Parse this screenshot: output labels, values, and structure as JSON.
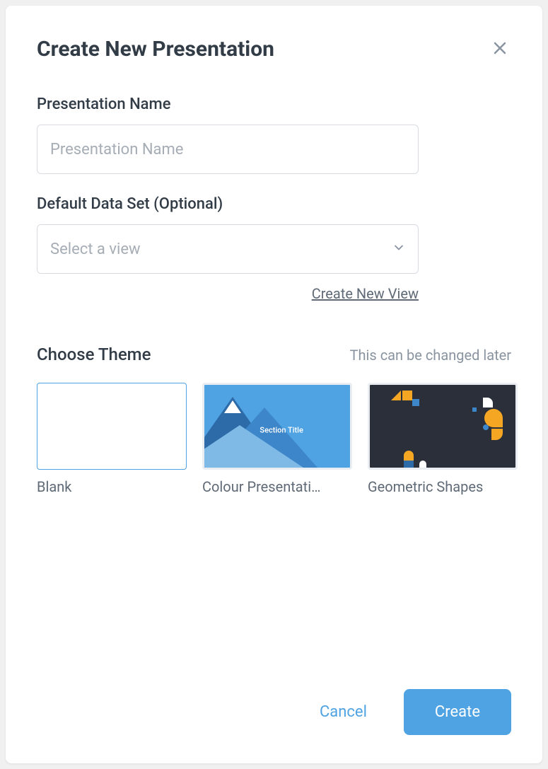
{
  "modal": {
    "title": "Create New Presentation"
  },
  "form": {
    "name_label": "Presentation Name",
    "name_placeholder": "Presentation Name",
    "name_value": "",
    "dataset_label": "Default Data Set (Optional)",
    "dataset_placeholder": "Select a view",
    "create_view_link": "Create New View"
  },
  "themes": {
    "title": "Choose Theme",
    "hint": "This can be changed later",
    "items": [
      {
        "label": "Blank",
        "selected": true
      },
      {
        "label": "Colour Presentati…",
        "selected": false,
        "preview_text": "Section Title"
      },
      {
        "label": "Geometric Shapes",
        "selected": false
      }
    ]
  },
  "footer": {
    "cancel": "Cancel",
    "create": "Create"
  }
}
